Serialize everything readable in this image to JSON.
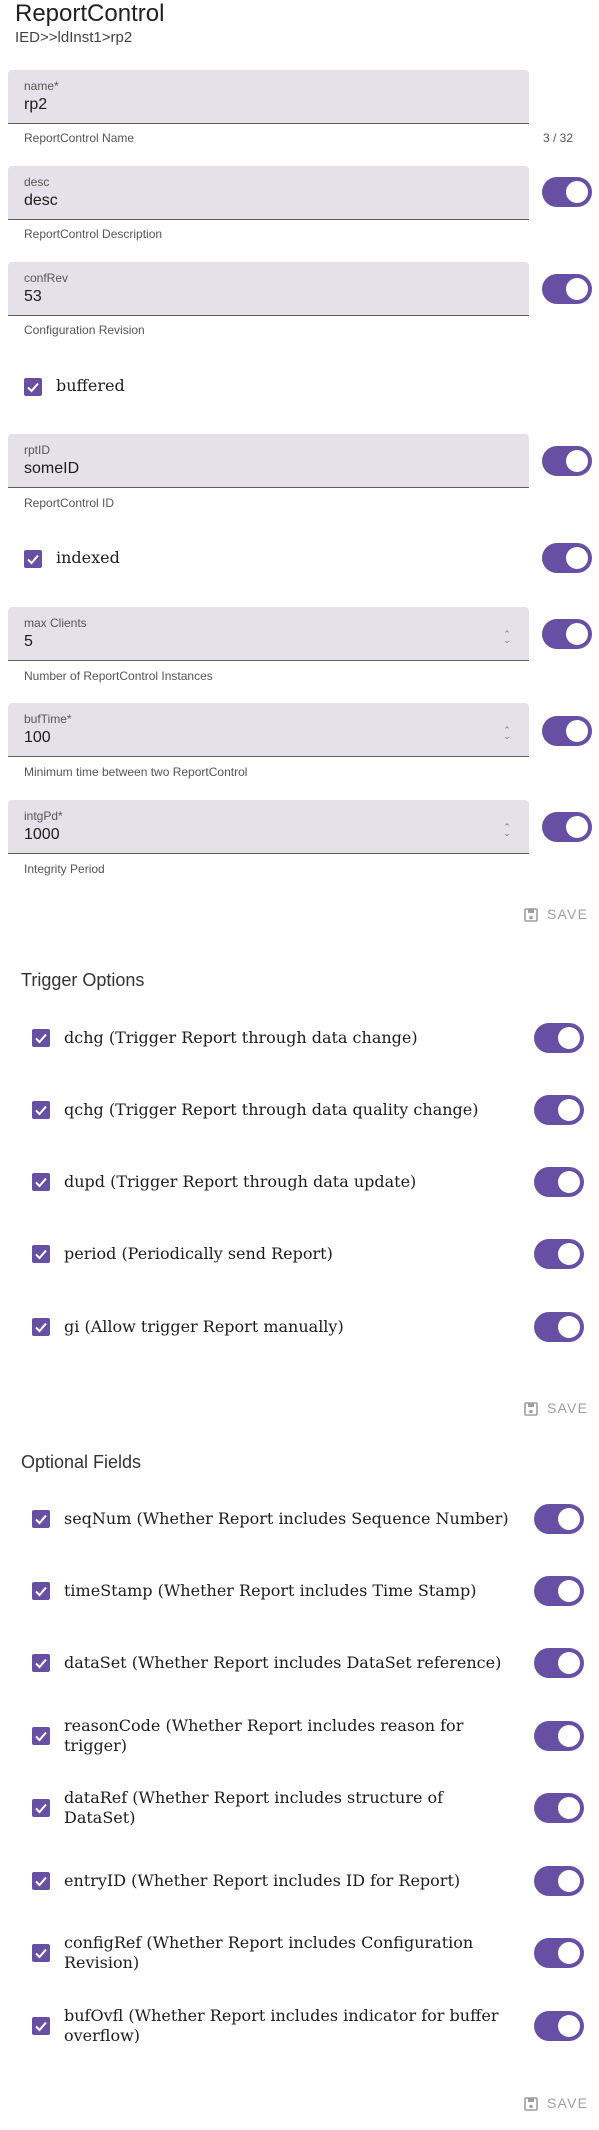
{
  "header": {
    "title": "ReportControl",
    "breadcrumb": "IED>>ldInst1>rp2"
  },
  "fields": {
    "name": {
      "label": "name*",
      "value": "rp2",
      "helper": "ReportControl Name",
      "counter": "3 / 32"
    },
    "desc": {
      "label": "desc",
      "value": "desc",
      "helper": "ReportControl Description"
    },
    "confRev": {
      "label": "confRev",
      "value": "53",
      "helper": "Configuration Revision"
    },
    "buffered": {
      "label": "buffered"
    },
    "rptID": {
      "label": "rptID",
      "value": "someID",
      "helper": "ReportControl ID"
    },
    "indexed": {
      "label": "indexed"
    },
    "maxClients": {
      "label": "max Clients",
      "value": "5",
      "helper": "Number of ReportControl Instances"
    },
    "bufTime": {
      "label": "bufTime*",
      "value": "100",
      "helper": "Minimum time between two ReportControl"
    },
    "intgPd": {
      "label": "intgPd*",
      "value": "1000",
      "helper": "Integrity Period"
    }
  },
  "save_label": "SAVE",
  "trigger": {
    "title": "Trigger Options",
    "items": [
      "dchg (Trigger Report through data change)",
      "qchg (Trigger Report through data quality change)",
      "dupd (Trigger Report through data update)",
      "period (Periodically send Report)",
      "gi (Allow trigger Report manually)"
    ]
  },
  "optional": {
    "title": "Optional Fields",
    "items": [
      "seqNum (Whether Report includes Sequence Number)",
      "timeStamp (Whether Report includes Time Stamp)",
      "dataSet (Whether Report includes DataSet reference)",
      "reasonCode (Whether Report includes reason for trigger)",
      "dataRef (Whether Report includes structure of DataSet)",
      "entryID (Whether Report includes ID for Report)",
      "configRef (Whether Report includes Configuration Revision)",
      "bufOvfl (Whether Report includes indicator for buffer overflow)"
    ]
  },
  "colors": {
    "accent": "#6750a4",
    "field_bg": "#e6e1e8"
  },
  "states": {
    "checked": true,
    "switch_on": true
  }
}
